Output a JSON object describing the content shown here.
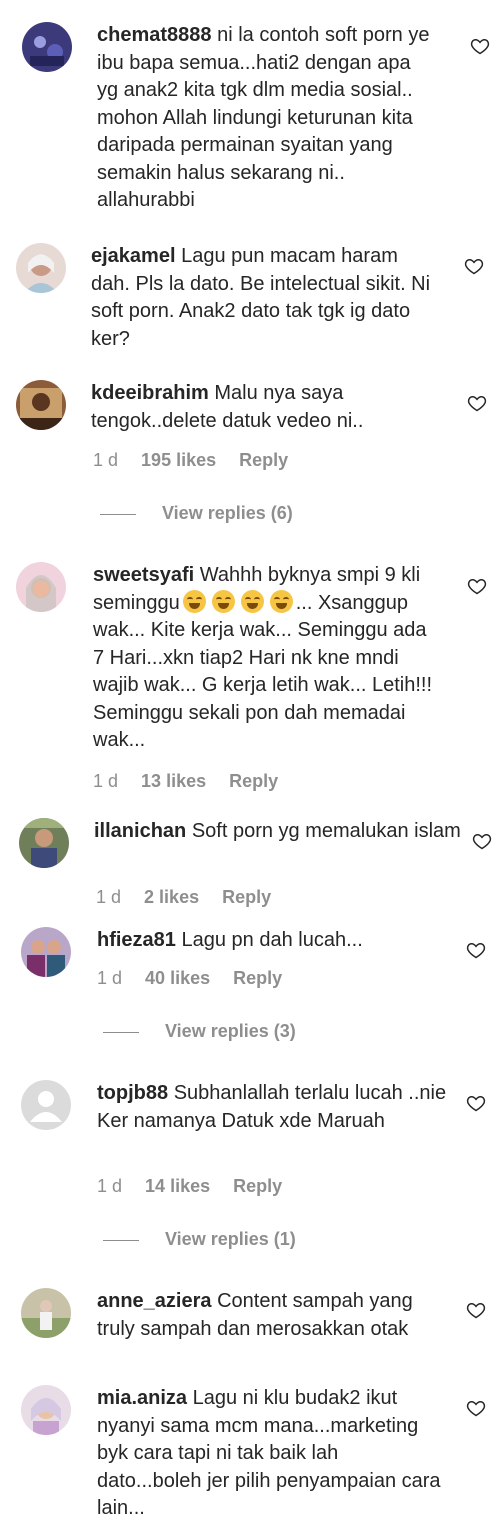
{
  "comments": [
    {
      "username": "chemat8888",
      "text": "ni la contoh soft porn ye ibu bapa semua...hati2 dengan apa yg anak2 kita tgk dlm media sosial.. mohon Allah lindungi keturunan kita daripada permainan syaitan yang semakin halus sekarang ni.. allahurabbi"
    },
    {
      "username": "ejakamel",
      "text": "Lagu pun macam haram dah. Pls la dato. Be intelectual sikit. Ni soft porn. Anak2 dato tak tgk ig dato ker?"
    },
    {
      "username": "kdeeibrahim",
      "text": "Malu nya saya tengok..delete datuk vedeo ni..",
      "time": "1 d",
      "likes": "195 likes",
      "reply": "Reply",
      "view_replies": "View replies (6)"
    },
    {
      "username": "sweetsyafi",
      "text_before": "Wahhh byknya smpi 9 kli seminggu",
      "emoji": "face-with-tears-of-joy",
      "emoji_count": 4,
      "text_after": "... Xsanggup wak... Kite kerja wak... Seminggu ada 7 Hari...xkn tiap2 Hari nk kne mndi wajib wak... G kerja letih wak... Letih!!! Seminggu sekali pon dah memadai wak...",
      "time": "1 d",
      "likes": "13 likes",
      "reply": "Reply"
    },
    {
      "username": "illanichan",
      "text": "Soft porn yg memalukan islam",
      "time": "1 d",
      "likes": "2 likes",
      "reply": "Reply"
    },
    {
      "username": "hfieza81",
      "text": "Lagu pn dah lucah...",
      "time": "1 d",
      "likes": "40 likes",
      "reply": "Reply",
      "view_replies": "View replies (3)"
    },
    {
      "username": "topjb88",
      "text": "Subhanlallah terlalu lucah ..nie Ker namanya Datuk xde Maruah",
      "time": "1 d",
      "likes": "14 likes",
      "reply": "Reply",
      "view_replies": "View replies (1)"
    },
    {
      "username": "anne_aziera",
      "text": "Content sampah yang truly sampah dan merosakkan otak"
    },
    {
      "username": "mia.aniza",
      "text": "Lagu ni klu budak2 ikut nyanyi sama mcm mana...marketing byk cara tapi ni tak baik lah dato...boleh jer pilih penyampaian cara lain..."
    }
  ],
  "colors": {
    "text": "#262626",
    "muted": "#8e8e8e"
  }
}
